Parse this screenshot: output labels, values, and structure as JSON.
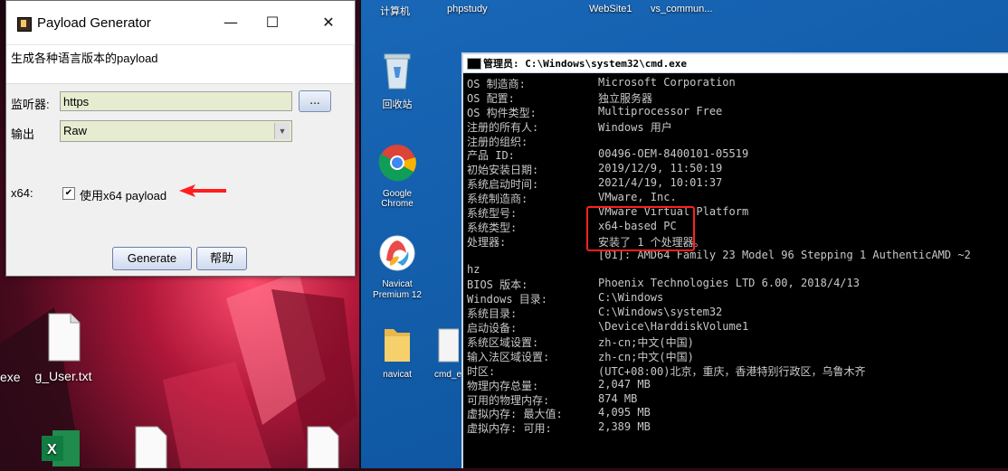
{
  "desktop_right": {
    "top_labels": [
      "计算机",
      "phpstudy",
      "WebSite1",
      "vs_commun..."
    ],
    "icons": [
      {
        "label": "回收站"
      },
      {
        "label": "Google Chrome"
      },
      {
        "label": "Navicat Premium 12"
      },
      {
        "label": "navicat"
      },
      {
        "label": "cmd_e"
      }
    ]
  },
  "desktop_left": {
    "icons": [
      {
        "label": "exe"
      },
      {
        "label": "g_User.txt"
      }
    ]
  },
  "payload_window": {
    "title": "Payload Generator",
    "minimize": "—",
    "maximize": "☐",
    "close": "✕",
    "description": "生成各种语言版本的payload",
    "listener_label": "监听器:",
    "listener_value": "https",
    "browse_label": "...",
    "output_label": "输出",
    "output_value": "Raw",
    "x64_label": "x64:",
    "x64_checkbox_label": "使用x64 payload",
    "x64_checked": true,
    "generate_button": "Generate",
    "help_button": "帮助"
  },
  "cmd_window": {
    "title": "管理员: C:\\Windows\\system32\\cmd.exe",
    "lines": [
      {
        "k": "OS 制造商:",
        "v": "Microsoft Corporation"
      },
      {
        "k": "OS 配置:",
        "v": "独立服务器"
      },
      {
        "k": "OS 构件类型:",
        "v": "Multiprocessor Free"
      },
      {
        "k": "注册的所有人:",
        "v": "Windows 用户"
      },
      {
        "k": "注册的组织:",
        "v": ""
      },
      {
        "k": "产品 ID:",
        "v": "00496-OEM-8400101-05519"
      },
      {
        "k": "初始安装日期:",
        "v": "2019/12/9, 11:50:19"
      },
      {
        "k": "系统启动时间:",
        "v": "2021/4/19, 10:01:37"
      },
      {
        "k": "系统制造商:",
        "v": "VMware, Inc."
      },
      {
        "k": "系统型号:",
        "v": "VMware Virtual Platform"
      },
      {
        "k": "系统类型:",
        "v": "x64-based PC"
      },
      {
        "k": "处理器:",
        "v": "安装了 1 个处理器。"
      },
      {
        "k": "",
        "v": "[01]: AMD64 Family 23 Model 96 Stepping 1 AuthenticAMD ~2"
      },
      {
        "k": "hz",
        "v": ""
      },
      {
        "k": "BIOS 版本:",
        "v": "Phoenix Technologies LTD 6.00, 2018/4/13"
      },
      {
        "k": "Windows 目录:",
        "v": "C:\\Windows"
      },
      {
        "k": "系统目录:",
        "v": "C:\\Windows\\system32"
      },
      {
        "k": "启动设备:",
        "v": "\\Device\\HarddiskVolume1"
      },
      {
        "k": "系统区域设置:",
        "v": "zh-cn;中文(中国)"
      },
      {
        "k": "输入法区域设置:",
        "v": "zh-cn;中文(中国)"
      },
      {
        "k": "时区:",
        "v": "(UTC+08:00)北京，重庆，香港特别行政区，乌鲁木齐"
      },
      {
        "k": "物理内存总量:",
        "v": "2,047 MB"
      },
      {
        "k": "可用的物理内存:",
        "v": "874 MB"
      },
      {
        "k": "虚拟内存: 最大值:",
        "v": "4,095 MB"
      },
      {
        "k": "虚拟内存: 可用:",
        "v": "2,389 MB"
      }
    ]
  }
}
